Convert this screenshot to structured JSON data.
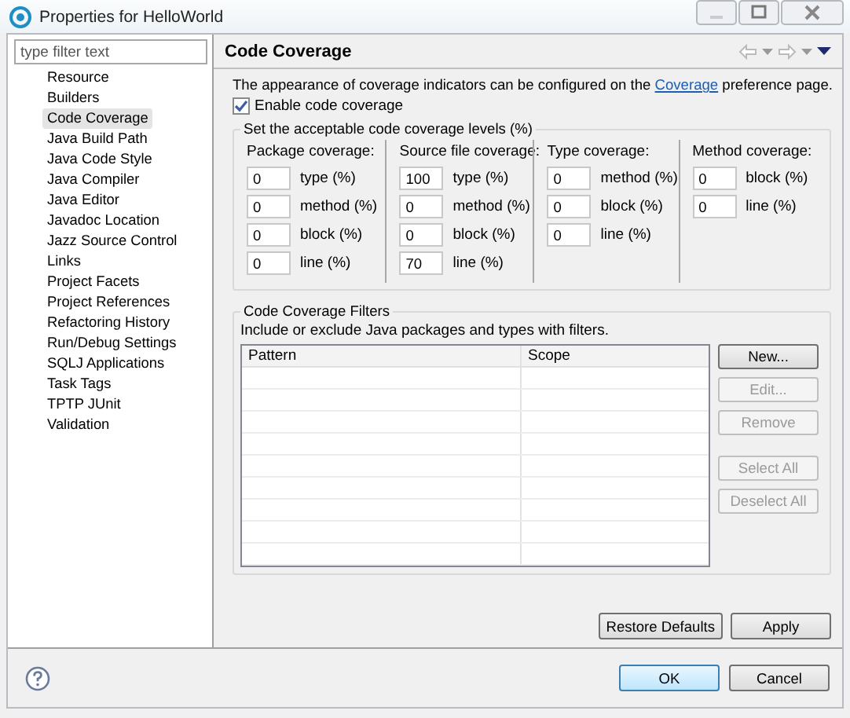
{
  "window": {
    "title": "Properties for HelloWorld"
  },
  "sidebar": {
    "filter": {
      "placeholder": "type filter text"
    },
    "items": [
      {
        "label": "Resource",
        "selected": false
      },
      {
        "label": "Builders",
        "selected": false
      },
      {
        "label": "Code Coverage",
        "selected": true
      },
      {
        "label": "Java Build Path",
        "selected": false
      },
      {
        "label": "Java Code Style",
        "selected": false
      },
      {
        "label": "Java Compiler",
        "selected": false
      },
      {
        "label": "Java Editor",
        "selected": false
      },
      {
        "label": "Javadoc Location",
        "selected": false
      },
      {
        "label": "Jazz Source Control",
        "selected": false
      },
      {
        "label": "Links",
        "selected": false
      },
      {
        "label": "Project Facets",
        "selected": false
      },
      {
        "label": "Project References",
        "selected": false
      },
      {
        "label": "Refactoring History",
        "selected": false
      },
      {
        "label": "Run/Debug Settings",
        "selected": false
      },
      {
        "label": "SQLJ Applications",
        "selected": false
      },
      {
        "label": "Task Tags",
        "selected": false
      },
      {
        "label": "TPTP JUnit",
        "selected": false
      },
      {
        "label": "Validation",
        "selected": false
      }
    ]
  },
  "page": {
    "title": "Code Coverage",
    "intro": {
      "before": "The appearance of coverage indicators can be configured on the ",
      "link": "Coverage",
      "after": " preference page."
    },
    "enable": {
      "label": "Enable code coverage",
      "checked": true
    },
    "levels": {
      "title": "Set the acceptable code coverage levels (%)",
      "columns": [
        {
          "heading": "Package coverage:",
          "fields": [
            {
              "value": "0",
              "label": "type (%)"
            },
            {
              "value": "0",
              "label": "method (%)"
            },
            {
              "value": "0",
              "label": "block (%)"
            },
            {
              "value": "0",
              "label": "line (%)"
            }
          ]
        },
        {
          "heading": "Source file coverage:",
          "fields": [
            {
              "value": "100",
              "label": "type (%)"
            },
            {
              "value": "0",
              "label": "method (%)"
            },
            {
              "value": "0",
              "label": "block (%)"
            },
            {
              "value": "70",
              "label": "line (%)"
            }
          ]
        },
        {
          "heading": "Type coverage:",
          "fields": [
            {
              "value": "0",
              "label": "method (%)"
            },
            {
              "value": "0",
              "label": "block (%)"
            },
            {
              "value": "0",
              "label": "line (%)"
            }
          ]
        },
        {
          "heading": "Method coverage:",
          "fields": [
            {
              "value": "0",
              "label": "block (%)"
            },
            {
              "value": "0",
              "label": "line (%)"
            }
          ]
        }
      ]
    },
    "filters": {
      "title": "Code Coverage Filters",
      "description": "Include or exclude Java packages and types with filters.",
      "table": {
        "columns": [
          "Pattern",
          "Scope"
        ]
      },
      "buttons": [
        {
          "label": "New...",
          "disabled": false
        },
        {
          "label": "Edit...",
          "disabled": true
        },
        {
          "label": "Remove",
          "disabled": true
        },
        {
          "label": "Select All",
          "disabled": true
        },
        {
          "label": "Deselect All",
          "disabled": true
        }
      ]
    },
    "buttons": [
      "Restore Defaults",
      "Apply"
    ]
  },
  "footer": {
    "buttons": [
      {
        "label": "OK",
        "default": true
      },
      {
        "label": "Cancel",
        "default": false
      }
    ]
  }
}
